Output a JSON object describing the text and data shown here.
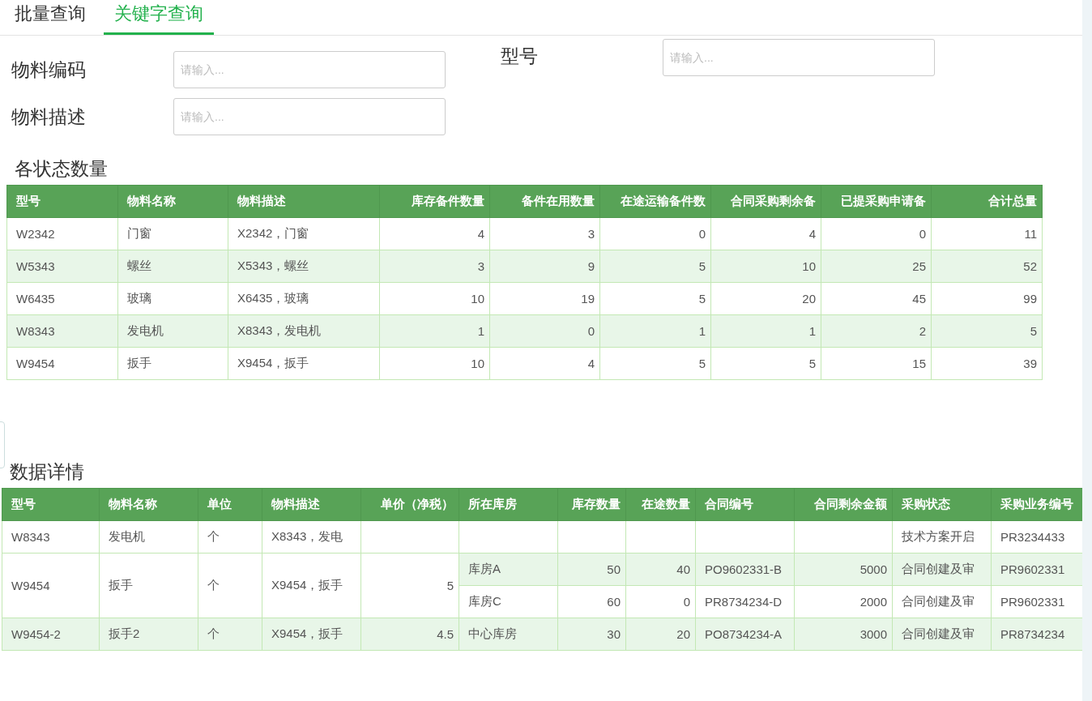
{
  "tabs": [
    {
      "label": "批量查询",
      "selected": false
    },
    {
      "label": "关键字查询",
      "selected": true
    }
  ],
  "form": {
    "left": [
      {
        "label": "物料编码",
        "placeholder": "请输入..."
      },
      {
        "label": "物料描述",
        "placeholder": "请输入..."
      }
    ],
    "right": [
      {
        "label": "型号",
        "placeholder": "请输入..."
      }
    ]
  },
  "summary": {
    "title": "各状态数量",
    "columns": [
      {
        "label": "型号",
        "numeric": false
      },
      {
        "label": "物料名称",
        "numeric": false
      },
      {
        "label": "物料描述",
        "numeric": false
      },
      {
        "label": "库存备件数量",
        "numeric": true
      },
      {
        "label": "备件在用数量",
        "numeric": true
      },
      {
        "label": "在途运输备件数",
        "numeric": true
      },
      {
        "label": "合同采购剩余备",
        "numeric": true
      },
      {
        "label": "已提采购申请备",
        "numeric": true
      },
      {
        "label": "合计总量",
        "numeric": true
      }
    ],
    "rows": [
      [
        "W2342",
        "门窗",
        "X2342，门窗",
        "4",
        "3",
        "0",
        "4",
        "0",
        "11"
      ],
      [
        "W5343",
        "螺丝",
        "X5343，螺丝",
        "3",
        "9",
        "5",
        "10",
        "25",
        "52"
      ],
      [
        "W6435",
        "玻璃",
        "X6435，玻璃",
        "10",
        "19",
        "5",
        "20",
        "45",
        "99"
      ],
      [
        "W8343",
        "发电机",
        "X8343，发电机",
        "1",
        "0",
        "1",
        "1",
        "2",
        "5"
      ],
      [
        "W9454",
        "扳手",
        "X9454，扳手",
        "10",
        "4",
        "5",
        "5",
        "15",
        "39"
      ]
    ]
  },
  "details": {
    "title": "数据详情",
    "columns": [
      {
        "label": "型号",
        "numeric": false
      },
      {
        "label": "物料名称",
        "numeric": false
      },
      {
        "label": "单位",
        "numeric": false
      },
      {
        "label": "物料描述",
        "numeric": false
      },
      {
        "label": "单价（净税）",
        "numeric": true
      },
      {
        "label": "所在库房",
        "numeric": false
      },
      {
        "label": "库存数量",
        "numeric": true
      },
      {
        "label": "在途数量",
        "numeric": true
      },
      {
        "label": "合同编号",
        "numeric": false
      },
      {
        "label": "合同剩余金额",
        "numeric": true
      },
      {
        "label": "采购状态",
        "numeric": false
      },
      {
        "label": "采购业务编号",
        "numeric": false
      }
    ],
    "rows": [
      {
        "model": "W8343",
        "name": "发电机",
        "unit": "个",
        "description": "X8343，发电",
        "lines": [
          {
            "purchase_status": "技术方案开启",
            "purchase_no": "PR3234433"
          }
        ]
      },
      {
        "model": "W9454",
        "name": "扳手",
        "unit": "个",
        "description": "X9454，扳手",
        "unit_price": "5",
        "lines": [
          {
            "warehouse": "库房A",
            "stock": "50",
            "in_transit": "40",
            "contract_no": "PO9602331-B",
            "contract_balance": "5000",
            "purchase_status": "合同创建及审",
            "purchase_no": "PR9602331"
          },
          {
            "warehouse": "库房C",
            "stock": "60",
            "in_transit": "0",
            "contract_no": "PR8734234-D",
            "contract_balance": "2000",
            "purchase_status": "合同创建及审",
            "purchase_no": "PR9602331"
          }
        ]
      },
      {
        "model": "W9454-2",
        "name": "扳手2",
        "unit": "个",
        "description": "X9454，扳手",
        "unit_price": "4.5",
        "lines": [
          {
            "warehouse": "中心库房",
            "stock": "30",
            "in_transit": "20",
            "contract_no": "PO8734234-A",
            "contract_balance": "3000",
            "purchase_status": "合同创建及审",
            "purchase_no": "PR8734234"
          }
        ]
      }
    ]
  }
}
